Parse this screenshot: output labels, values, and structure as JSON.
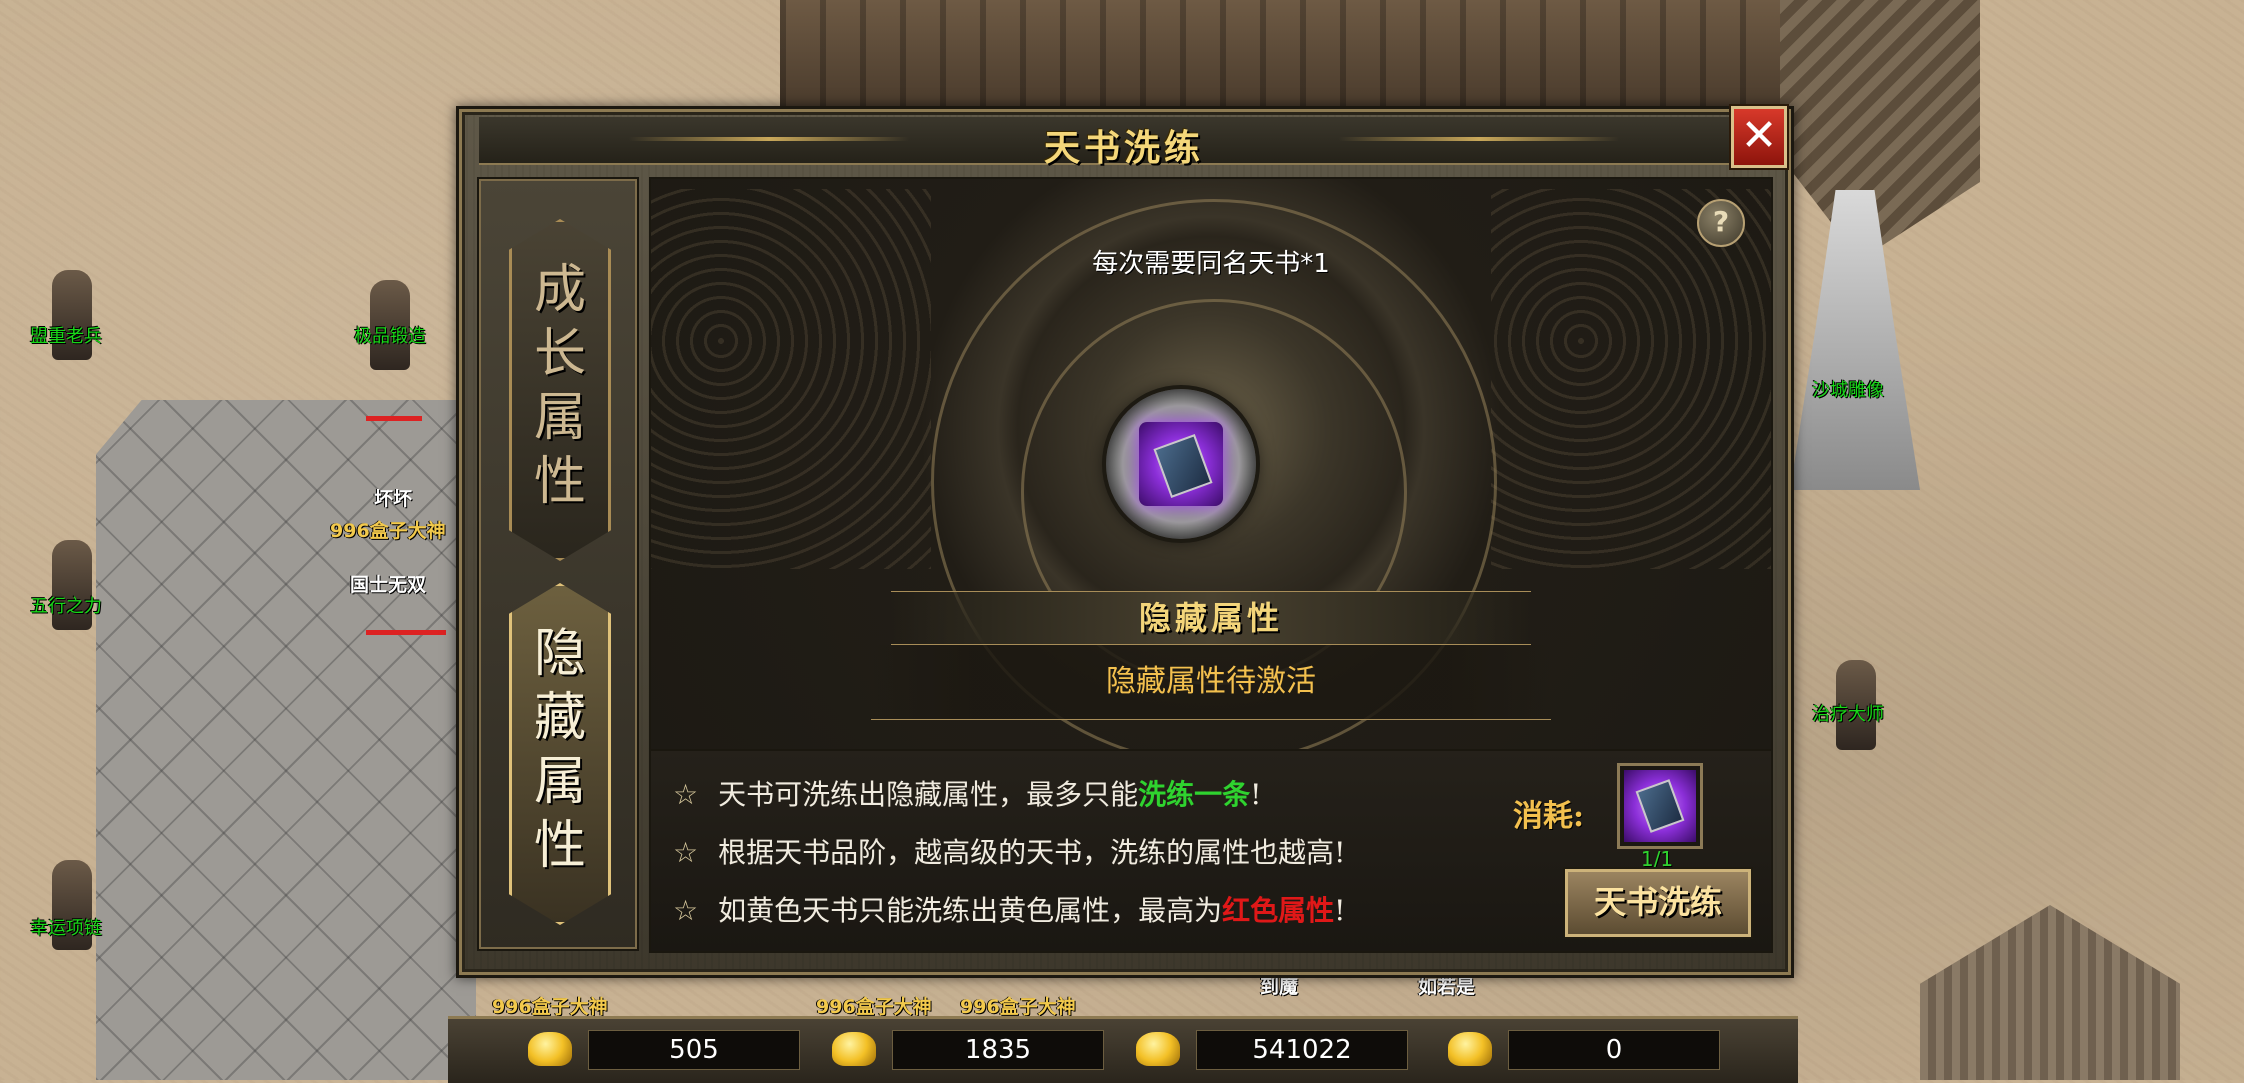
{
  "world": {
    "npcs": [
      "盟重老兵",
      "极品锻造",
      "五行之力",
      "幸运项链",
      "沙城雕像",
      "治疗大师"
    ],
    "player_labels": [
      "坏坏",
      "996盒子大神",
      "国士无双",
      "996盒子大神",
      "996盒子大神",
      "996盒子大神",
      "如若是",
      "到魔"
    ]
  },
  "dialog": {
    "title": "天书洗练",
    "close_icon": "✕",
    "help_icon": "?",
    "tabs": [
      {
        "label": "成长属性",
        "active": false
      },
      {
        "label": "隐藏属性",
        "active": true
      }
    ],
    "requirement": "每次需要同名天书*1",
    "hidden_title": "隐藏属性",
    "hidden_status": "隐藏属性待激活",
    "rules": {
      "star": "☆",
      "r1_pre": "天书可洗练出隐藏属性，最多只能",
      "r1_hl": "洗练一条",
      "r1_post": "!",
      "r2": "根据天书品阶，越高级的天书，洗练的属性也越高!",
      "r3_pre": "如黄色天书只能洗练出黄色属性，最高为",
      "r3_hl": "红色属性",
      "r3_post": "!"
    },
    "cost_label": "消耗:",
    "cost_count": "1/1",
    "refine_button": "天书洗练"
  },
  "currency": {
    "yuanbao": "505",
    "bound_yuanbao": "1835",
    "gold": "541022",
    "bound_gold": "0"
  },
  "colors": {
    "title_gold": "#f4d77a",
    "highlight_green": "#2fd32f",
    "highlight_red": "#e01818",
    "npc_green": "#18d818"
  }
}
